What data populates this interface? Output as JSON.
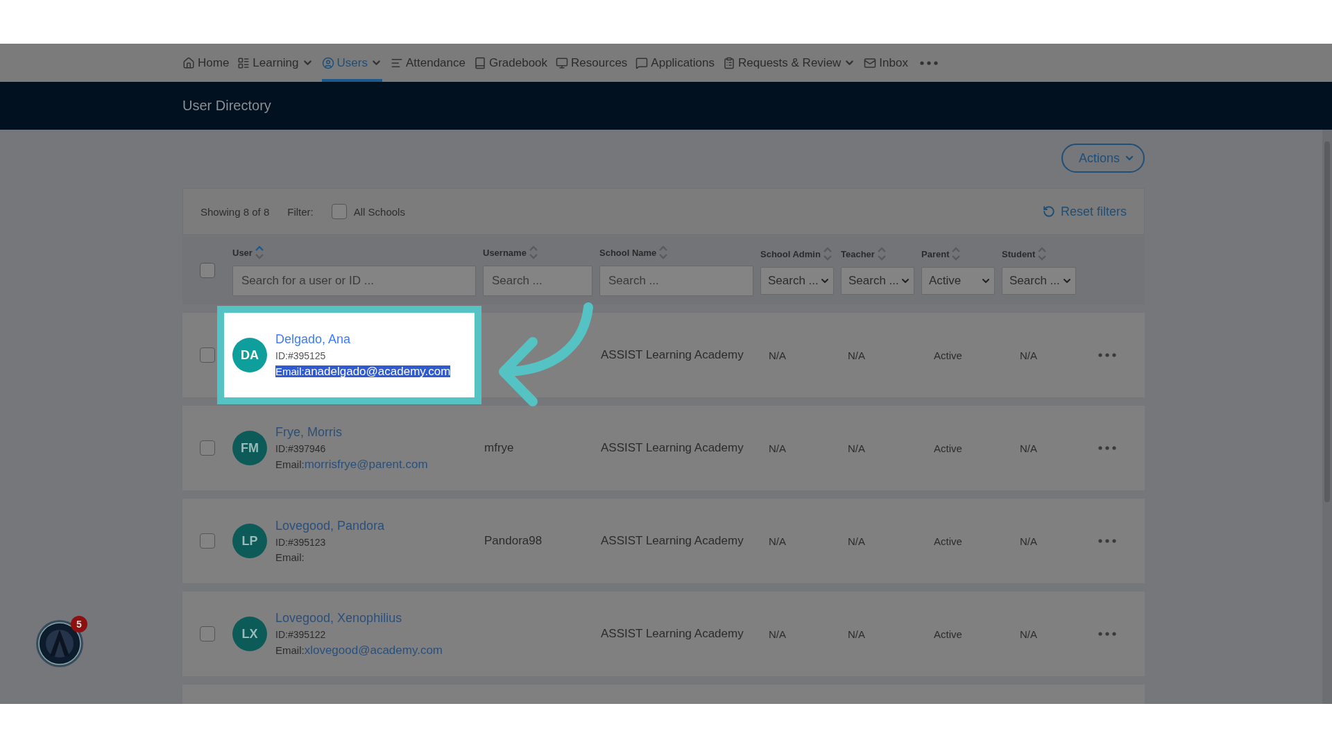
{
  "nav": {
    "items": [
      {
        "label": "Home",
        "selected": false,
        "has_menu": false
      },
      {
        "label": "Learning",
        "selected": false,
        "has_menu": true
      },
      {
        "label": "Users",
        "selected": true,
        "has_menu": true
      },
      {
        "label": "Attendance",
        "selected": false,
        "has_menu": false
      },
      {
        "label": "Gradebook",
        "selected": false,
        "has_menu": false
      },
      {
        "label": "Resources",
        "selected": false,
        "has_menu": false
      },
      {
        "label": "Applications",
        "selected": false,
        "has_menu": false
      },
      {
        "label": "Requests & Review",
        "selected": false,
        "has_menu": true
      },
      {
        "label": "Inbox",
        "selected": false,
        "has_menu": false
      }
    ]
  },
  "header": {
    "title": "User Directory"
  },
  "actions_button": {
    "label": "Actions"
  },
  "filter_bar": {
    "showing": "Showing 8 of 8",
    "filter_label": "Filter:",
    "all_schools": {
      "label": "All Schools",
      "checked": false
    },
    "reset": "Reset filters"
  },
  "table": {
    "select_all_checked": false,
    "columns": [
      {
        "label": "User",
        "sorted": true,
        "filter": {
          "kind": "text",
          "placeholder": "Search for a user or ID ..."
        }
      },
      {
        "label": "Username",
        "sorted": false,
        "filter": {
          "kind": "text",
          "placeholder": "Search ..."
        }
      },
      {
        "label": "School Name",
        "sorted": false,
        "filter": {
          "kind": "text",
          "placeholder": "Search ..."
        }
      },
      {
        "label": "School Admin",
        "sorted": false,
        "filter": {
          "kind": "select",
          "placeholder": "Search ..."
        }
      },
      {
        "label": "Teacher",
        "sorted": false,
        "filter": {
          "kind": "select",
          "placeholder": "Search ..."
        }
      },
      {
        "label": "Parent",
        "sorted": false,
        "filter": {
          "kind": "select",
          "value": "Active"
        }
      },
      {
        "label": "Student",
        "sorted": false,
        "filter": {
          "kind": "select",
          "placeholder": "Search ..."
        }
      }
    ],
    "rows": [
      {
        "checked": false,
        "highlighted": true,
        "initials": "DA",
        "name": "Delgado, Ana",
        "id": "ID:#395125",
        "email_label": "Email:",
        "email": "anadelgado@academy.com",
        "email_selected": true,
        "school": "ASSIST Learning Academy",
        "school_admin": "N/A",
        "teacher": "N/A",
        "parent": "Active",
        "student": "N/A"
      },
      {
        "checked": false,
        "highlighted": false,
        "initials": "FM",
        "name": "Frye, Morris",
        "id": "ID:#397946",
        "email_label": "Email:",
        "email": "morrisfrye@parent.com",
        "email_selected": false,
        "username": "mfrye",
        "school": "ASSIST Learning Academy",
        "school_admin": "N/A",
        "teacher": "N/A",
        "parent": "Active",
        "student": "N/A"
      },
      {
        "checked": false,
        "highlighted": false,
        "initials": "LP",
        "name": "Lovegood, Pandora",
        "id": "ID:#395123",
        "email_label": "Email:",
        "email_selected": false,
        "username": "Pandora98",
        "school": "ASSIST Learning Academy",
        "school_admin": "N/A",
        "teacher": "N/A",
        "parent": "Active",
        "student": "N/A"
      },
      {
        "checked": false,
        "highlighted": false,
        "initials": "LX",
        "name": "Lovegood, Xenophilius",
        "id": "ID:#395122",
        "email_label": "Email:",
        "email": "xlovegood@academy.com",
        "email_selected": false,
        "school": "ASSIST Learning Academy",
        "school_admin": "N/A",
        "teacher": "N/A",
        "parent": "Active",
        "student": "N/A"
      }
    ]
  },
  "help_widget": {
    "badge": "5"
  }
}
